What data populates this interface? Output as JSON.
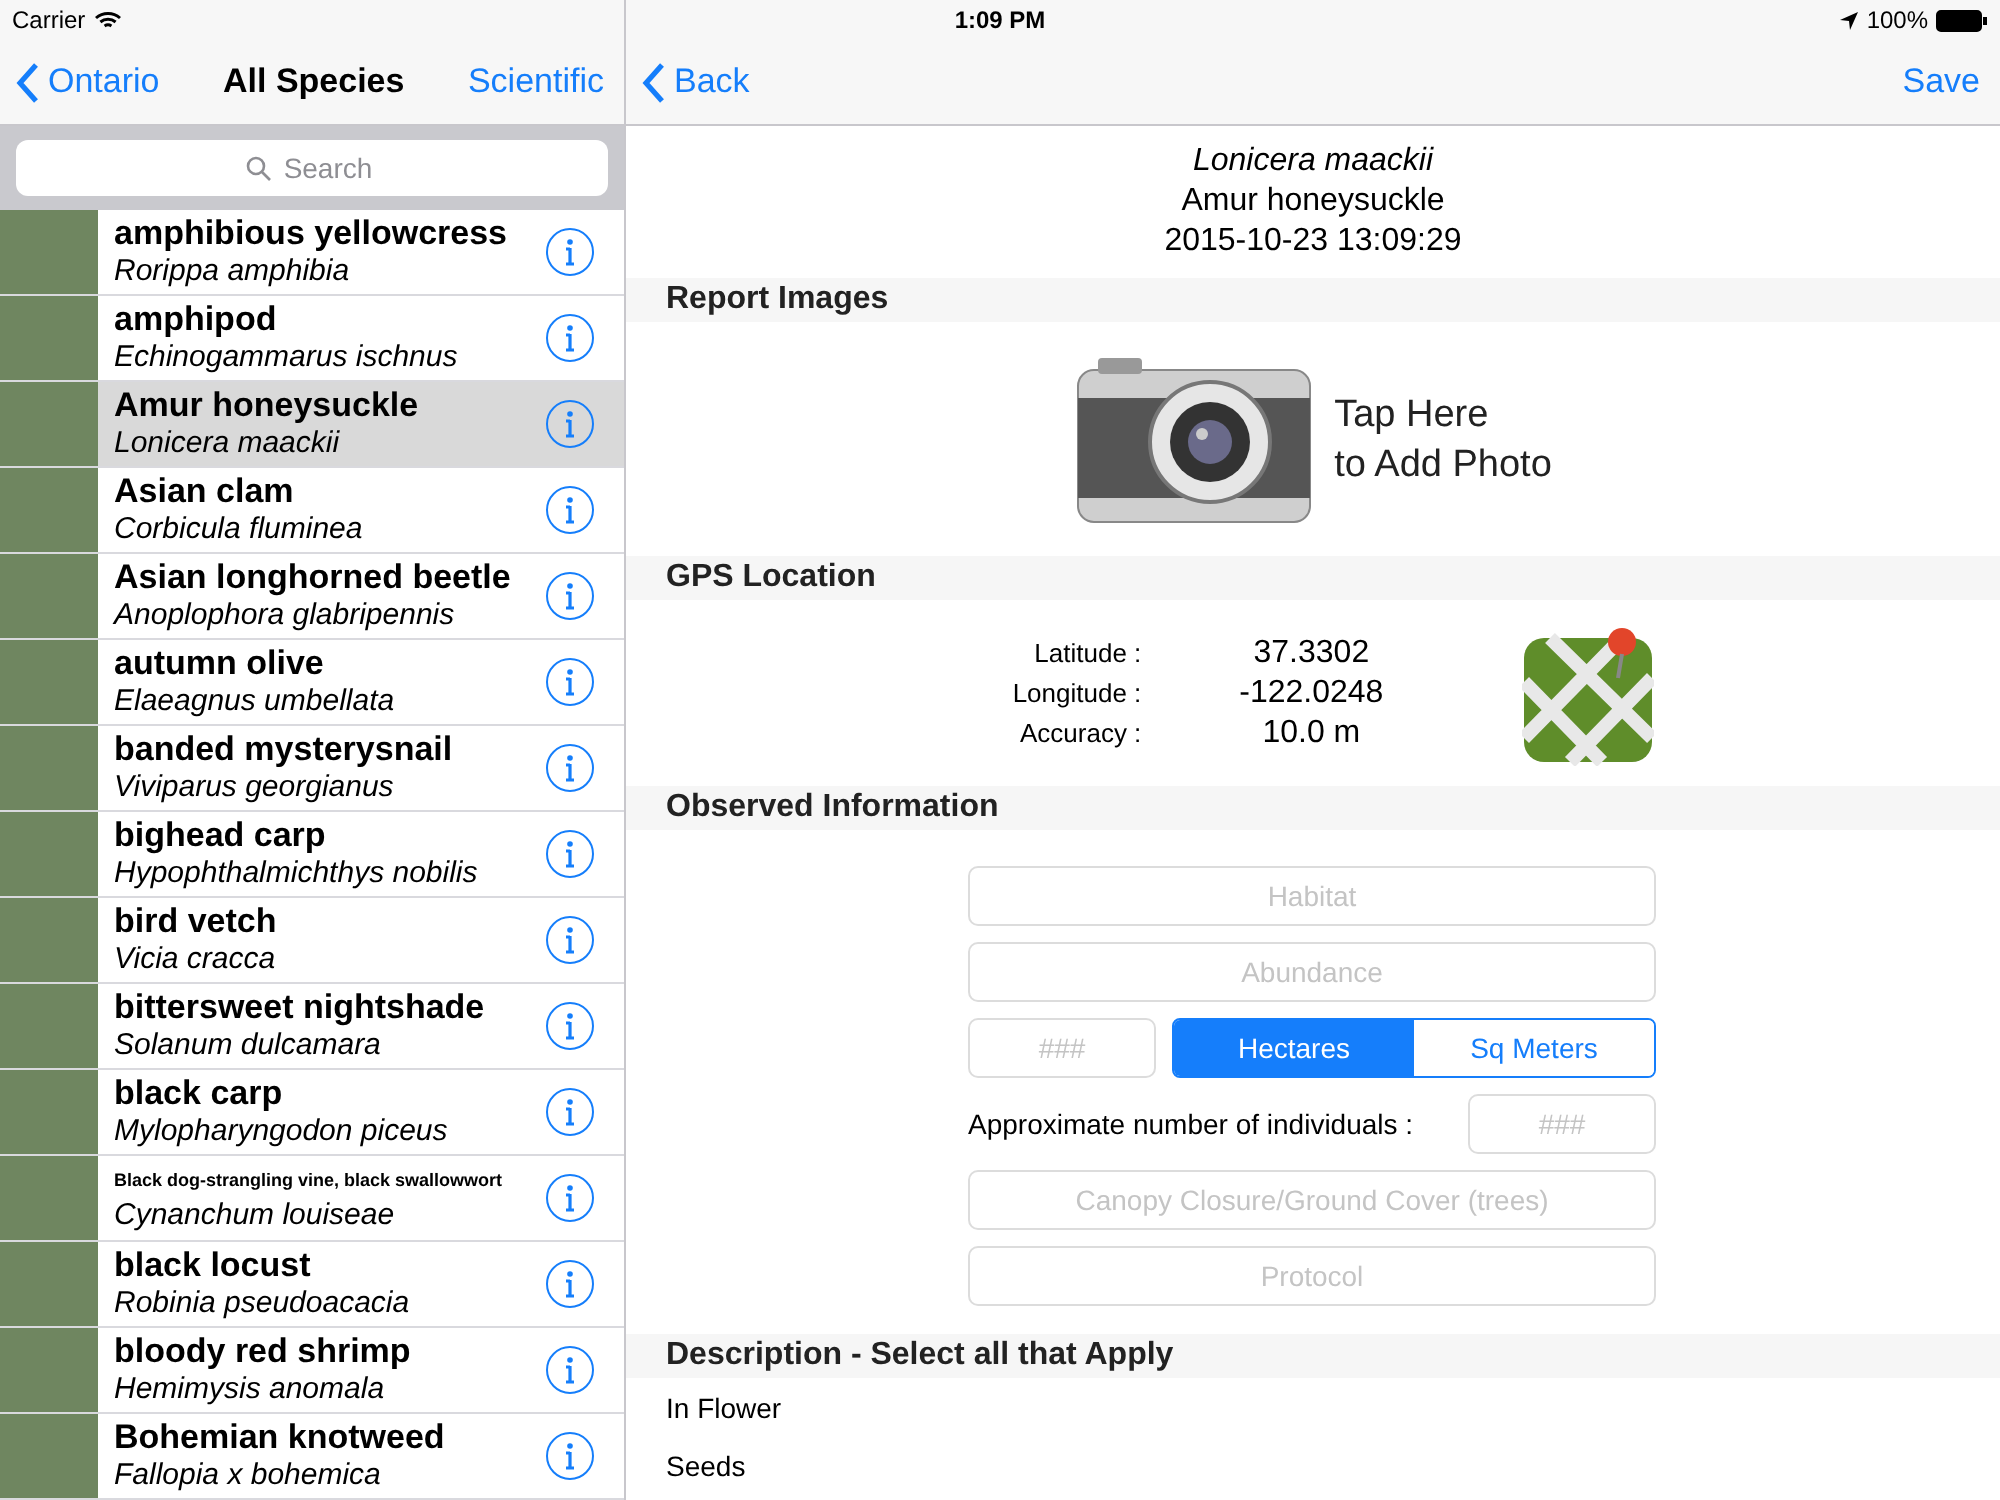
{
  "status_bar": {
    "carrier": "Carrier",
    "time": "1:09 PM",
    "battery": "100%"
  },
  "left_nav": {
    "back": "Ontario",
    "title": "All Species",
    "action": "Scientific"
  },
  "search": {
    "placeholder": "Search"
  },
  "species": [
    {
      "name": "amphibious yellowcress",
      "scientific": "Rorippa amphibia",
      "kind": "normal",
      "selected": false
    },
    {
      "name": "amphipod",
      "scientific": "Echinogammarus ischnus",
      "kind": "normal",
      "selected": false
    },
    {
      "name": "Amur honeysuckle",
      "scientific": "Lonicera maackii",
      "kind": "normal",
      "selected": true
    },
    {
      "name": "Asian clam",
      "scientific": "Corbicula fluminea",
      "kind": "normal",
      "selected": false
    },
    {
      "name": "Asian longhorned beetle",
      "scientific": "Anoplophora glabripennis",
      "kind": "normal",
      "selected": false
    },
    {
      "name": "autumn olive",
      "scientific": "Elaeagnus umbellata",
      "kind": "normal",
      "selected": false
    },
    {
      "name": "banded mysterysnail",
      "scientific": "Viviparus georgianus",
      "kind": "normal",
      "selected": false
    },
    {
      "name": "bighead carp",
      "scientific": "Hypophthalmichthys nobilis",
      "kind": "normal",
      "selected": false
    },
    {
      "name": "bird vetch",
      "scientific": "Vicia cracca",
      "kind": "normal",
      "selected": false
    },
    {
      "name": "bittersweet nightshade",
      "scientific": "Solanum dulcamara",
      "kind": "normal",
      "selected": false
    },
    {
      "name": "black carp",
      "scientific": "Mylopharyngodon piceus",
      "kind": "normal",
      "selected": false
    },
    {
      "name": "Black dog-strangling vine, black swallowwort",
      "scientific": "Cynanchum louiseae",
      "kind": "small",
      "selected": false
    },
    {
      "name": "black locust",
      "scientific": "Robinia pseudoacacia",
      "kind": "normal",
      "selected": false
    },
    {
      "name": "bloody red shrimp",
      "scientific": "Hemimysis anomala",
      "kind": "normal",
      "selected": false
    },
    {
      "name": "Bohemian knotweed",
      "scientific": "Fallopia x bohemica",
      "kind": "normal",
      "selected": false
    }
  ],
  "right_nav": {
    "back": "Back",
    "action": "Save"
  },
  "report": {
    "scientific": "Lonicera maackii",
    "common": "Amur honeysuckle",
    "timestamp": "2015-10-23 13:09:29"
  },
  "sections": {
    "images": "Report Images",
    "gps": "GPS Location",
    "observed": "Observed Information",
    "description": "Description - Select all that Apply"
  },
  "add_photo": {
    "lines": [
      "Tap Here",
      "to Add Photo"
    ]
  },
  "gps": [
    {
      "label": "Latitude :",
      "value": "37.3302"
    },
    {
      "label": "Longitude :",
      "value": "-122.0248"
    },
    {
      "label": "Accuracy :",
      "value": "10.0 m"
    }
  ],
  "observed": {
    "habitat": {
      "placeholder": "Habitat"
    },
    "abundance": {
      "placeholder": "Abundance"
    },
    "area": {
      "placeholder": "###"
    },
    "units": [
      {
        "label": "Hectares",
        "selected": true
      },
      {
        "label": "Sq Meters",
        "selected": false
      }
    ],
    "individuals": {
      "label": "Approximate number of individuals :",
      "placeholder": "###"
    },
    "canopy": {
      "placeholder": "Canopy Closure/Ground Cover (trees)"
    },
    "protocol": {
      "placeholder": "Protocol"
    }
  },
  "description_items": [
    "In Flower",
    "Seeds"
  ]
}
